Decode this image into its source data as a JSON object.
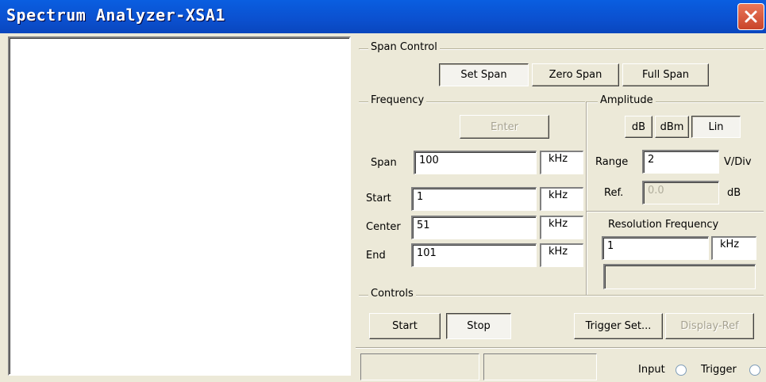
{
  "window": {
    "title": "Spectrum Analyzer-XSA1"
  },
  "span_control": {
    "legend": "Span Control",
    "buttons": [
      "Set Span",
      "Zero Span",
      "Full Span"
    ],
    "selected": "Set Span"
  },
  "frequency": {
    "legend": "Frequency",
    "enter_label": "Enter",
    "span": {
      "label": "Span",
      "value": "100",
      "unit": "kHz"
    },
    "start": {
      "label": "Start",
      "value": "1",
      "unit": "kHz"
    },
    "center": {
      "label": "Center",
      "value": "51",
      "unit": "kHz"
    },
    "end": {
      "label": "End",
      "value": "101",
      "unit": "kHz"
    }
  },
  "amplitude": {
    "legend": "Amplitude",
    "buttons": [
      "dB",
      "dBm",
      "Lin"
    ],
    "selected": "Lin",
    "range": {
      "label": "Range",
      "value": "2",
      "unit": "V/Div"
    },
    "ref": {
      "label": "Ref.",
      "value": "0.0",
      "unit": "dB"
    }
  },
  "resolution": {
    "label": "Resolution Frequency",
    "value": "1",
    "unit": "kHz"
  },
  "controls": {
    "legend": "Controls",
    "start_label": "Start",
    "stop_label": "Stop",
    "trigger_set_label": "Trigger Set...",
    "display_ref_label": "Display-Ref"
  },
  "status": {
    "input_label": "Input",
    "trigger_label": "Trigger"
  }
}
